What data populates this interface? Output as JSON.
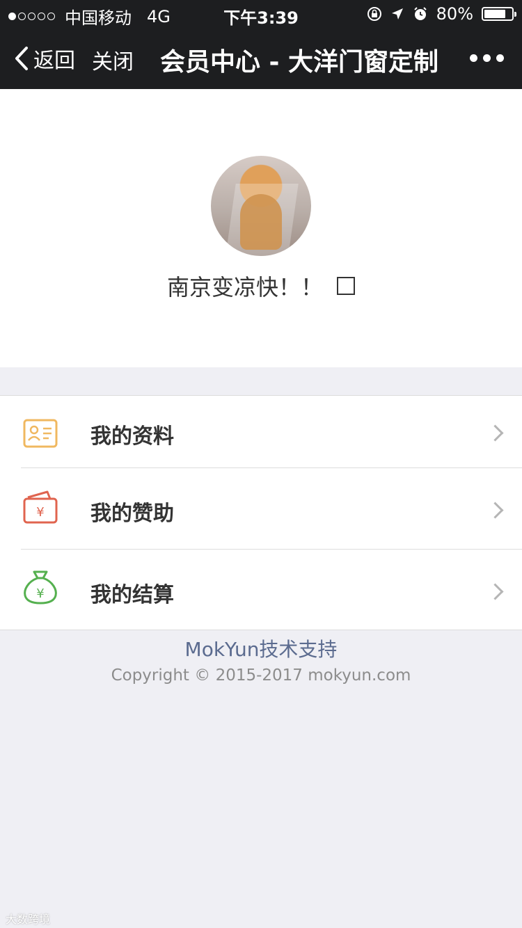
{
  "status_bar": {
    "carrier": "中国移动",
    "network": "4G",
    "time": "下午3:39",
    "battery": "80%",
    "battery_level": 0.8
  },
  "nav": {
    "back": "返回",
    "close": "关闭",
    "title": "会员中心 - 大洋门窗定制"
  },
  "profile": {
    "nickname": "南京变凉快！！"
  },
  "menu": {
    "items": [
      {
        "label": "我的资料",
        "icon": "id-card-icon"
      },
      {
        "label": "我的赞助",
        "icon": "wallet-yen-icon"
      },
      {
        "label": "我的结算",
        "icon": "money-bag-icon"
      }
    ]
  },
  "footer": {
    "support": "MokYun技术支持",
    "copyright": "Copyright © 2015-2017 mokyun.com"
  },
  "watermark": "大数跨境",
  "colors": {
    "nav_bg": "#1d1e20",
    "profile_icon": "#f0b860",
    "wallet_icon": "#e0644f",
    "money_icon": "#55b04f",
    "support_link": "#5b6b8f"
  }
}
